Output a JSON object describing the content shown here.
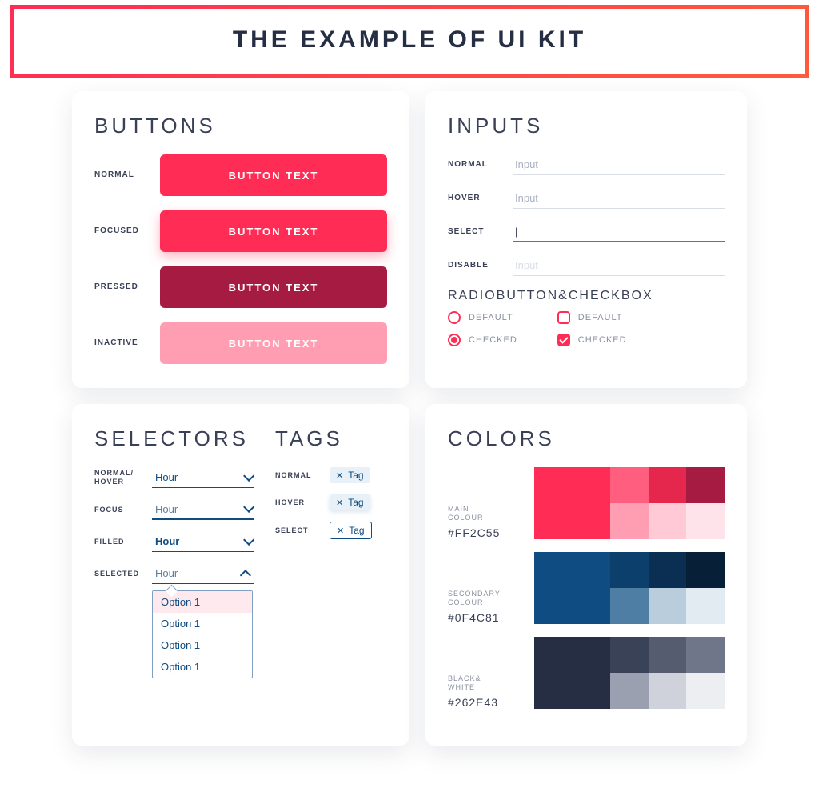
{
  "banner": {
    "title": "THE EXAMPLE OF UI KIT"
  },
  "buttons": {
    "heading": "BUTTONS",
    "states": {
      "normal": {
        "label": "NORMAL",
        "text": "BUTTON TEXT"
      },
      "focused": {
        "label": "FOCUSED",
        "text": "BUTTON TEXT"
      },
      "pressed": {
        "label": "PRESSED",
        "text": "BUTTON TEXT"
      },
      "inactive": {
        "label": "INACTIVE",
        "text": "BUTTON TEXT"
      }
    }
  },
  "inputs": {
    "heading": "INPUTS",
    "rows": {
      "normal": {
        "label": "NORMAL",
        "placeholder": "Input"
      },
      "hover": {
        "label": "HOVER",
        "placeholder": "Input"
      },
      "select": {
        "label": "SELECT",
        "value": "|"
      },
      "disable": {
        "label": "DISABLE",
        "placeholder": "Input"
      }
    },
    "radiocheck": {
      "heading": "RADIOBUTTON&CHECKBOX",
      "radio_default": "DEFAULT",
      "radio_checked": "CHECKED",
      "check_default": "DEFAULT",
      "check_checked": "CHECKED"
    }
  },
  "selectors": {
    "heading": "SELECTORS",
    "rows": {
      "normal": {
        "label": "NORMAL/\nHOVER",
        "value": "Hour"
      },
      "focus": {
        "label": "FOCUS",
        "value": "Hour"
      },
      "filled": {
        "label": "FILLED",
        "value": "Hour"
      },
      "selected": {
        "label": "SELECTED",
        "value": "Hour"
      }
    },
    "options": [
      "Option 1",
      "Option 1",
      "Option 1",
      "Option 1"
    ]
  },
  "tags": {
    "heading": "TAGS",
    "rows": {
      "normal": {
        "label": "NORMAL",
        "text": "Tag"
      },
      "hover": {
        "label": "HOVER",
        "text": "Tag"
      },
      "select": {
        "label": "SELECT",
        "text": "Tag"
      }
    }
  },
  "colors": {
    "heading": "COLORS",
    "palettes": [
      {
        "name": "MAIN\nCOLOUR",
        "hex": "#FF2C55",
        "swatches": [
          "#ff2c55",
          "#ff5e7e",
          "#e5274e",
          "#a61b42",
          "#ff9eb2",
          "#ffc9d5",
          "#ffe3ea"
        ]
      },
      {
        "name": "SECONDARY\nCOLOUR",
        "hex": "#0F4C81",
        "swatches": [
          "#0f4c81",
          "#0d3f6c",
          "#0a2f52",
          "#081f38",
          "#4f7ea5",
          "#b9cddd",
          "#e3ebf2"
        ]
      },
      {
        "name": "BLACK&\nWHITE",
        "hex": "#262E43",
        "swatches": [
          "#262e43",
          "#3a4257",
          "#555c70",
          "#6f7689",
          "#9ba0b0",
          "#cfd2da",
          "#eceef2"
        ]
      }
    ]
  }
}
